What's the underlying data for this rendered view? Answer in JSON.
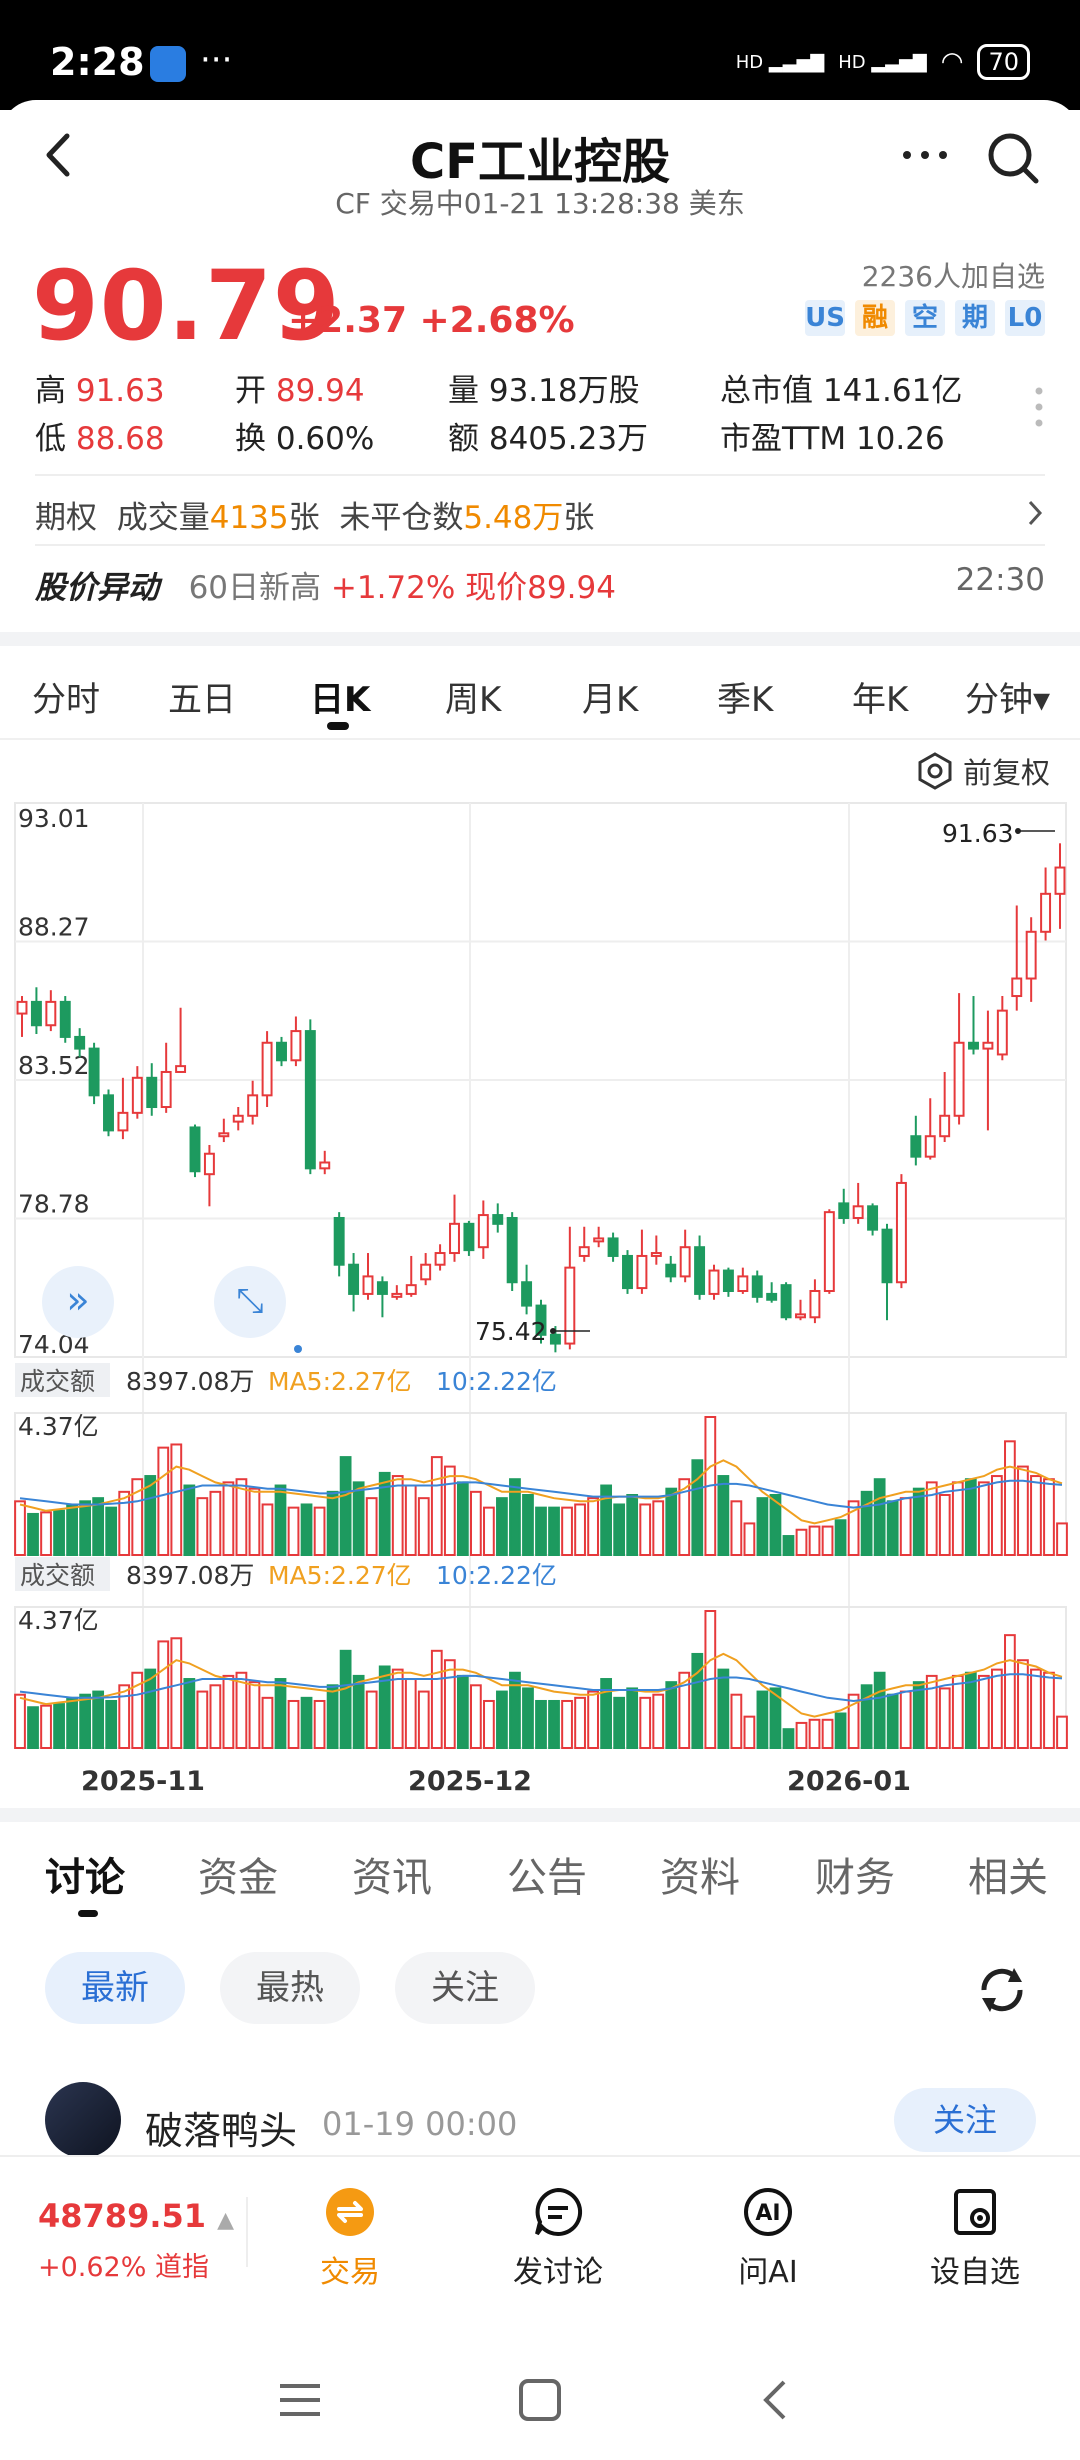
{
  "status_bar": {
    "time": "2:28",
    "signal1": "HD",
    "signal2": "HD",
    "battery": "70"
  },
  "header": {
    "title": "CF工业控股",
    "subtitle": "CF 交易中01-21 13:28:38 美东"
  },
  "quote": {
    "price": "90.79",
    "change": "+2.37 +2.68%",
    "watchers": "2236人加自选",
    "tags": [
      {
        "label": "US",
        "color": "#3a84d6",
        "bg": "#e6f0fb"
      },
      {
        "label": "融",
        "color": "#f08a00",
        "bg": "#fdf0dc"
      },
      {
        "label": "空",
        "color": "#3a84d6",
        "bg": "#e6f0fb"
      },
      {
        "label": "期",
        "color": "#3a84d6",
        "bg": "#e6f0fb"
      },
      {
        "label": "L0",
        "color": "#3a84d6",
        "bg": "#e6f0fb"
      }
    ],
    "high_label": "高",
    "high": "91.63",
    "open_label": "开",
    "open": "89.94",
    "volume_label": "量",
    "volume": "93.18万股",
    "mcap_label": "总市值",
    "mcap": "141.61亿",
    "low_label": "低",
    "low": "88.68",
    "turnover_label": "换",
    "turnover": "0.60%",
    "amount_label": "额",
    "amount": "8405.23万",
    "pe_label": "市盈TTM",
    "pe": "10.26"
  },
  "options_row": {
    "label": "期权",
    "vol_label": "成交量",
    "vol": "4135",
    "vol_unit": "张",
    "oi_label": "未平仓数",
    "oi": "5.48万",
    "oi_unit": "张"
  },
  "alert": {
    "title": "股价异动",
    "text1": "60日新高",
    "text2": "+1.72% 现价89.94",
    "time": "22:30"
  },
  "ktabs": [
    "分时",
    "五日",
    "日K",
    "周K",
    "月K",
    "季K",
    "年K",
    "分钟▾"
  ],
  "adjust_label": "前复权",
  "chart_data": {
    "type": "candlestick",
    "y_ticks": [
      "93.01",
      "88.27",
      "83.52",
      "78.78",
      "74.04"
    ],
    "ylim": [
      74.04,
      93.01
    ],
    "high_marker": "91.63",
    "low_marker": "75.42",
    "x_ticks": [
      "2025-11",
      "2025-12",
      "2026-01"
    ],
    "candles": [
      [
        85.8,
        86.2,
        85.0,
        86.4
      ],
      [
        86.2,
        85.4,
        85.1,
        86.7
      ],
      [
        85.4,
        86.2,
        85.2,
        86.6
      ],
      [
        86.2,
        85.0,
        84.8,
        86.4
      ],
      [
        85.0,
        84.6,
        84.3,
        85.3
      ],
      [
        84.6,
        83.0,
        82.7,
        84.8
      ],
      [
        83.0,
        81.8,
        81.6,
        83.2
      ],
      [
        81.8,
        82.4,
        81.5,
        83.6
      ],
      [
        82.4,
        83.6,
        82.2,
        84.0
      ],
      [
        83.6,
        82.6,
        82.3,
        84.1
      ],
      [
        82.6,
        83.8,
        82.4,
        84.8
      ],
      [
        83.8,
        84.0,
        83.8,
        86.0
      ],
      [
        81.9,
        80.4,
        80.2,
        82.0
      ],
      [
        80.3,
        81.0,
        79.2,
        81.3
      ],
      [
        81.6,
        81.7,
        81.4,
        82.2
      ],
      [
        82.1,
        82.3,
        81.8,
        82.6
      ],
      [
        82.3,
        83.0,
        82.0,
        83.5
      ],
      [
        83.0,
        84.8,
        82.6,
        85.2
      ],
      [
        84.8,
        84.2,
        84.0,
        85.0
      ],
      [
        84.2,
        85.2,
        84.0,
        85.7
      ],
      [
        85.2,
        80.5,
        80.3,
        85.6
      ],
      [
        80.5,
        80.7,
        80.3,
        81.1
      ],
      [
        78.8,
        77.2,
        76.8,
        79.0
      ],
      [
        77.2,
        76.2,
        75.6,
        77.6
      ],
      [
        76.2,
        76.8,
        76.0,
        77.6
      ],
      [
        76.6,
        76.2,
        75.4,
        76.8
      ],
      [
        76.1,
        76.2,
        76.0,
        76.5
      ],
      [
        76.2,
        76.5,
        76.1,
        77.5
      ],
      [
        76.7,
        77.2,
        76.5,
        77.6
      ],
      [
        77.2,
        77.6,
        77.0,
        77.9
      ],
      [
        77.6,
        78.6,
        77.3,
        79.6
      ],
      [
        78.6,
        77.7,
        77.5,
        78.7
      ],
      [
        77.8,
        78.9,
        77.4,
        79.4
      ],
      [
        78.9,
        78.6,
        78.3,
        79.3
      ],
      [
        78.8,
        76.6,
        76.3,
        79.0
      ],
      [
        76.6,
        75.8,
        75.5,
        77.2
      ],
      [
        75.8,
        74.8,
        74.5,
        76.0
      ],
      [
        74.8,
        74.5,
        74.2,
        75.1
      ],
      [
        74.5,
        77.1,
        74.3,
        78.5
      ],
      [
        77.5,
        77.8,
        77.3,
        78.5
      ],
      [
        78.0,
        78.1,
        77.8,
        78.5
      ],
      [
        78.1,
        77.5,
        77.3,
        78.3
      ],
      [
        77.5,
        76.4,
        76.2,
        77.7
      ],
      [
        76.4,
        77.5,
        76.2,
        78.4
      ],
      [
        77.5,
        77.6,
        77.2,
        78.2
      ],
      [
        77.2,
        76.8,
        76.6,
        77.5
      ],
      [
        76.8,
        77.8,
        76.6,
        78.4
      ],
      [
        77.8,
        76.2,
        76.0,
        78.2
      ],
      [
        76.2,
        77.0,
        76.0,
        77.2
      ],
      [
        77.0,
        76.3,
        76.1,
        77.1
      ],
      [
        76.3,
        76.8,
        76.2,
        77.1
      ],
      [
        76.8,
        76.1,
        75.9,
        77.0
      ],
      [
        76.2,
        76.0,
        75.9,
        76.6
      ],
      [
        76.5,
        75.4,
        75.3,
        76.6
      ],
      [
        75.4,
        75.5,
        75.3,
        76.0
      ],
      [
        75.4,
        76.3,
        75.2,
        76.7
      ],
      [
        76.3,
        79.0,
        76.2,
        79.1
      ],
      [
        79.3,
        78.8,
        78.6,
        79.8
      ],
      [
        78.8,
        79.2,
        78.6,
        80.0
      ],
      [
        79.2,
        78.4,
        78.2,
        79.3
      ],
      [
        78.4,
        76.6,
        75.3,
        78.6
      ],
      [
        76.6,
        80.0,
        76.4,
        80.3
      ],
      [
        81.6,
        80.9,
        80.6,
        82.3
      ],
      [
        80.9,
        81.6,
        80.8,
        82.9
      ],
      [
        81.6,
        82.3,
        81.4,
        83.8
      ],
      [
        82.3,
        84.8,
        82.0,
        86.5
      ],
      [
        84.8,
        84.6,
        84.4,
        86.4
      ],
      [
        84.6,
        84.8,
        81.8,
        85.9
      ],
      [
        84.4,
        85.9,
        84.2,
        86.4
      ],
      [
        86.4,
        87.0,
        85.9,
        89.5
      ],
      [
        87.0,
        88.6,
        86.2,
        89.1
      ],
      [
        88.6,
        89.9,
        88.3,
        90.8
      ],
      [
        89.9,
        90.8,
        88.7,
        91.63
      ]
    ],
    "volume_panels": [
      {
        "label": "成交额",
        "value": "8397.08万",
        "ma5": "MA5:2.27亿",
        "ma10": "10:2.22亿",
        "max": "4.37亿"
      },
      {
        "label": "成交额",
        "value": "8397.08万",
        "ma5": "MA5:2.27亿",
        "ma10": "10:2.22亿",
        "max": "4.37亿"
      }
    ],
    "volumes": [
      1.7,
      1.3,
      1.35,
      1.4,
      1.6,
      1.7,
      1.8,
      1.5,
      2.0,
      2.4,
      2.5,
      3.4,
      3.5,
      2.2,
      1.8,
      2.0,
      2.3,
      2.4,
      2.1,
      1.6,
      2.2,
      1.5,
      1.6,
      1.5,
      2.0,
      3.1,
      2.3,
      1.8,
      2.6,
      2.5,
      2.2,
      1.8,
      3.1,
      2.8,
      2.3,
      2.0,
      1.5,
      1.8,
      2.4,
      1.9,
      1.5,
      1.5,
      1.5,
      1.6,
      1.8,
      2.2,
      1.6,
      1.9,
      1.6,
      1.7,
      2.1,
      2.4,
      3.0,
      4.37,
      2.5,
      1.7,
      1.0,
      1.8,
      1.9,
      0.6,
      0.8,
      0.9,
      0.9,
      1.1,
      1.7,
      2.0,
      2.4,
      1.7,
      1.8,
      2.1,
      2.3,
      1.9,
      2.3,
      2.4,
      2.3,
      2.5,
      3.6,
      2.8,
      2.5,
      2.4,
      1.0
    ],
    "ma5": [
      1.6,
      1.5,
      1.4,
      1.45,
      1.5,
      1.55,
      1.6,
      1.7,
      1.8,
      2.0,
      2.2,
      2.5,
      2.8,
      2.7,
      2.5,
      2.3,
      2.2,
      2.1,
      2.0,
      2.0,
      2.0,
      1.95,
      1.9,
      1.85,
      1.8,
      1.9,
      2.1,
      2.2,
      2.3,
      2.4,
      2.4,
      2.3,
      2.4,
      2.5,
      2.5,
      2.4,
      2.2,
      2.0,
      2.0,
      2.0,
      1.9,
      1.8,
      1.75,
      1.7,
      1.7,
      1.8,
      1.85,
      1.85,
      1.8,
      1.8,
      1.9,
      2.1,
      2.4,
      2.8,
      3.0,
      2.8,
      2.4,
      2.0,
      1.7,
      1.4,
      1.1,
      1.0,
      1.1,
      1.2,
      1.4,
      1.6,
      1.8,
      1.9,
      2.0,
      2.0,
      2.1,
      2.2,
      2.3,
      2.4,
      2.5,
      2.7,
      2.8,
      2.7,
      2.6,
      2.4,
      2.27
    ],
    "ma10": [
      1.8,
      1.75,
      1.7,
      1.65,
      1.6,
      1.6,
      1.6,
      1.62,
      1.65,
      1.7,
      1.8,
      1.9,
      2.0,
      2.1,
      2.2,
      2.2,
      2.2,
      2.2,
      2.15,
      2.1,
      2.1,
      2.05,
      2.0,
      1.95,
      1.95,
      2.0,
      2.05,
      2.1,
      2.15,
      2.2,
      2.2,
      2.2,
      2.2,
      2.25,
      2.3,
      2.3,
      2.25,
      2.2,
      2.15,
      2.1,
      2.05,
      2.0,
      1.95,
      1.9,
      1.85,
      1.85,
      1.85,
      1.85,
      1.85,
      1.85,
      1.9,
      2.0,
      2.1,
      2.2,
      2.25,
      2.25,
      2.2,
      2.1,
      2.0,
      1.9,
      1.8,
      1.7,
      1.6,
      1.55,
      1.5,
      1.55,
      1.6,
      1.7,
      1.8,
      1.85,
      1.9,
      2.0,
      2.05,
      2.1,
      2.2,
      2.3,
      2.35,
      2.35,
      2.3,
      2.25,
      2.22
    ]
  },
  "bottom_tabs": [
    "讨论",
    "资金",
    "资讯",
    "公告",
    "资料",
    "财务",
    "相关"
  ],
  "filters": [
    "最新",
    "最热",
    "关注"
  ],
  "post": {
    "user": "破落鸭头",
    "time": "01-19 00:00",
    "follow": "关注"
  },
  "index": {
    "value": "48789.51",
    "change": "+0.62% 道指"
  },
  "bottom_nav": [
    {
      "label": "交易",
      "icon": "trade-icon"
    },
    {
      "label": "发讨论",
      "icon": "comment-icon"
    },
    {
      "label": "问AI",
      "icon": "ai-icon"
    },
    {
      "label": "设自选",
      "icon": "watchlist-icon"
    }
  ],
  "colors": {
    "up": "#e6393b",
    "down": "#1d9a5f",
    "ma5": "#f0a020",
    "ma10": "#3a84d6"
  }
}
